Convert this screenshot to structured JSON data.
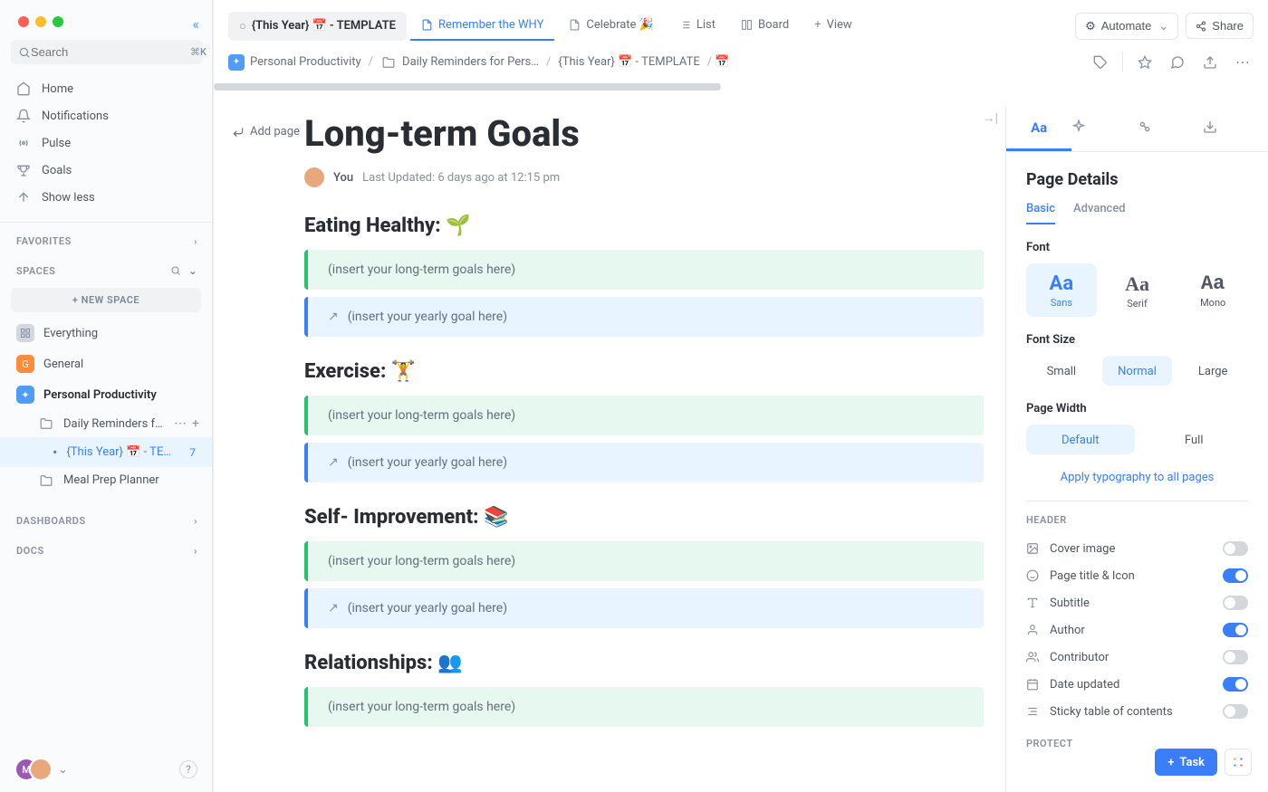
{
  "search": {
    "placeholder": "Search",
    "shortcut": "⌘K"
  },
  "sidebar": {
    "nav": [
      {
        "label": "Home"
      },
      {
        "label": "Notifications"
      },
      {
        "label": "Pulse"
      },
      {
        "label": "Goals"
      },
      {
        "label": "Show less"
      }
    ],
    "favorites_label": "FAVORITES",
    "spaces_label": "SPACES",
    "new_space": "+ NEW SPACE",
    "items": [
      {
        "label": "Everything"
      },
      {
        "label": "General"
      },
      {
        "label": "Personal Productivity"
      },
      {
        "label": "Daily Reminders f…"
      },
      {
        "label": "{This Year} 📅 - TE…",
        "count": 7
      },
      {
        "label": "Meal Prep Planner"
      }
    ],
    "dashboards_label": "DASHBOARDS",
    "docs_label": "DOCS",
    "avatar_initial": "M"
  },
  "topbar": {
    "tabs": [
      {
        "label": "{This Year} 📅 - TEMPLATE"
      },
      {
        "label": "Remember the WHY"
      },
      {
        "label": "Celebrate 🎉"
      },
      {
        "label": "List"
      },
      {
        "label": "Board"
      },
      {
        "label": "View"
      }
    ],
    "automate": "Automate",
    "share": "Share"
  },
  "breadcrumb": [
    "Personal Productivity",
    "Daily Reminders for Pers…",
    "{This Year} 📅 - TEMPLATE"
  ],
  "doc": {
    "add_page": "Add page",
    "title": "Long-term Goals",
    "author": "You",
    "updated": "Last Updated:  6 days ago at 12:15 pm",
    "sections": [
      {
        "heading": "Eating Healthy: 🌱",
        "long": "(insert your long-term goals here)",
        "year": "(insert your yearly goal here)"
      },
      {
        "heading": "Exercise: 🏋️",
        "long": "(insert your long-term goals here)",
        "year": "(insert your yearly goal here)"
      },
      {
        "heading": "Self- Improvement: 📚",
        "long": "(insert your long-term goals here)",
        "year": "(insert your yearly goal here)"
      },
      {
        "heading": "Relationships: 👥",
        "long": "(insert your long-term goals here)",
        "year": ""
      }
    ]
  },
  "panel": {
    "title": "Page Details",
    "tabs": [
      "Basic",
      "Advanced"
    ],
    "font_label": "Font",
    "fonts": [
      "Sans",
      "Serif",
      "Mono"
    ],
    "size_label": "Font Size",
    "sizes": [
      "Small",
      "Normal",
      "Large"
    ],
    "width_label": "Page Width",
    "widths": [
      "Default",
      "Full"
    ],
    "apply_all": "Apply typography to all pages",
    "header_label": "HEADER",
    "rows": [
      {
        "label": "Cover image",
        "on": false
      },
      {
        "label": "Page title & Icon",
        "on": true
      },
      {
        "label": "Subtitle",
        "on": false
      },
      {
        "label": "Author",
        "on": true
      },
      {
        "label": "Contributor",
        "on": false
      },
      {
        "label": "Date updated",
        "on": true
      },
      {
        "label": "Sticky table of contents",
        "on": false
      }
    ],
    "protect_label": "PROTECT"
  },
  "fab": {
    "task": "Task"
  }
}
